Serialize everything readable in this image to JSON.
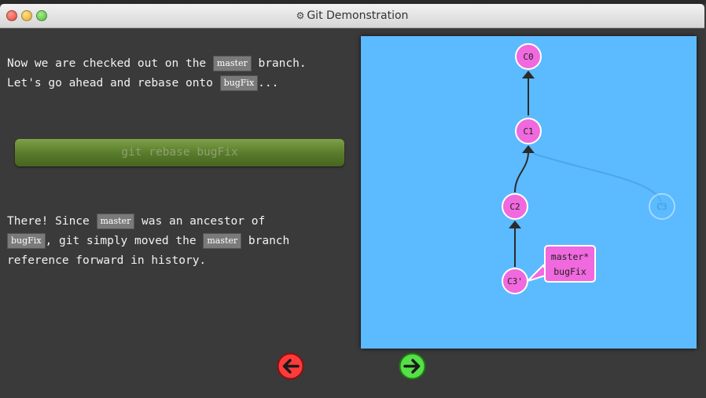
{
  "window": {
    "title": "Git Demonstration",
    "title_icon": "gear-icon"
  },
  "intro": {
    "line1_a": "Now we are checked out on the ",
    "line1_code": "master",
    "line1_b": " branch.",
    "line2_a": "Let's go ahead and rebase onto ",
    "line2_code": "bugFix",
    "line2_b": "..."
  },
  "command": {
    "label": "git rebase bugFix"
  },
  "result": {
    "line1_a": "There! Since ",
    "line1_code": "master",
    "line1_b": " was an ancestor of",
    "line2_code": "bugFix",
    "line2_a": ", git simply moved the ",
    "line2_code2": "master",
    "line2_b": " branch",
    "line3": "reference forward in history."
  },
  "graph": {
    "commits": {
      "c0": "C0",
      "c1": "C1",
      "c2": "C2",
      "c3_old": "C3",
      "c3_new": "C3'"
    },
    "branch_label": {
      "line1": "master*",
      "line2": "bugFix"
    }
  },
  "navigation": {
    "back_icon": "left-arrow-icon",
    "forward_icon": "right-arrow-icon"
  },
  "colors": {
    "canvas": "#5cbaff",
    "commit": "#f069de",
    "back_button": "#ff3a3a",
    "forward_button": "#55e048",
    "button_green": "#567a2a"
  }
}
